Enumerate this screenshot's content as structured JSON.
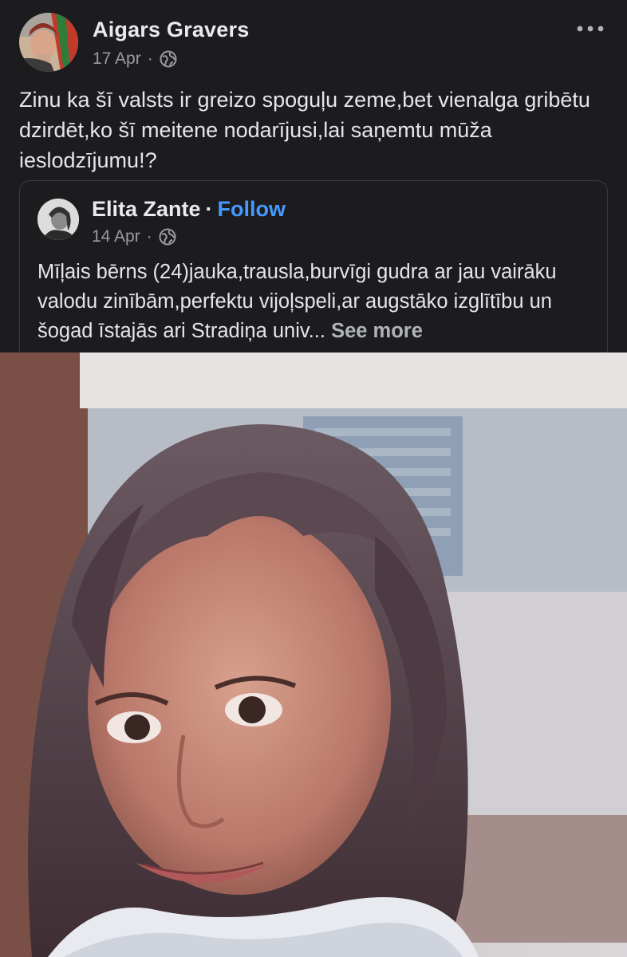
{
  "post": {
    "author_name": "Aigars Gravers",
    "date": "17 Apr",
    "separator": "·",
    "privacy_icon": "globe-icon",
    "more_icon": "more-horizontal-icon",
    "text": "Zinu ka šī valsts ir greizo spoguļu zeme,bet vienalga gribētu dzirdēt,ko šī meitene nodarījusi,lai saņemtu mūža ieslodzījumu!?"
  },
  "shared": {
    "author_name": "Elita Zante",
    "separator": "·",
    "follow_label": "Follow",
    "date": "14 Apr",
    "privacy_icon": "globe-icon",
    "text": "Mīļais bērns (24)jauka,trausla,burvīgi gudra ar jau vairāku valodu zinībām,perfektu vijoļspeli,ar augstāko izglītību un šogad īstajās ari Stradiņa univ...",
    "see_more_label": "See more"
  },
  "colors": {
    "background": "#1c1c1e",
    "text": "#e4e6eb",
    "meta": "#9a9ca1",
    "follow": "#4599ff"
  }
}
